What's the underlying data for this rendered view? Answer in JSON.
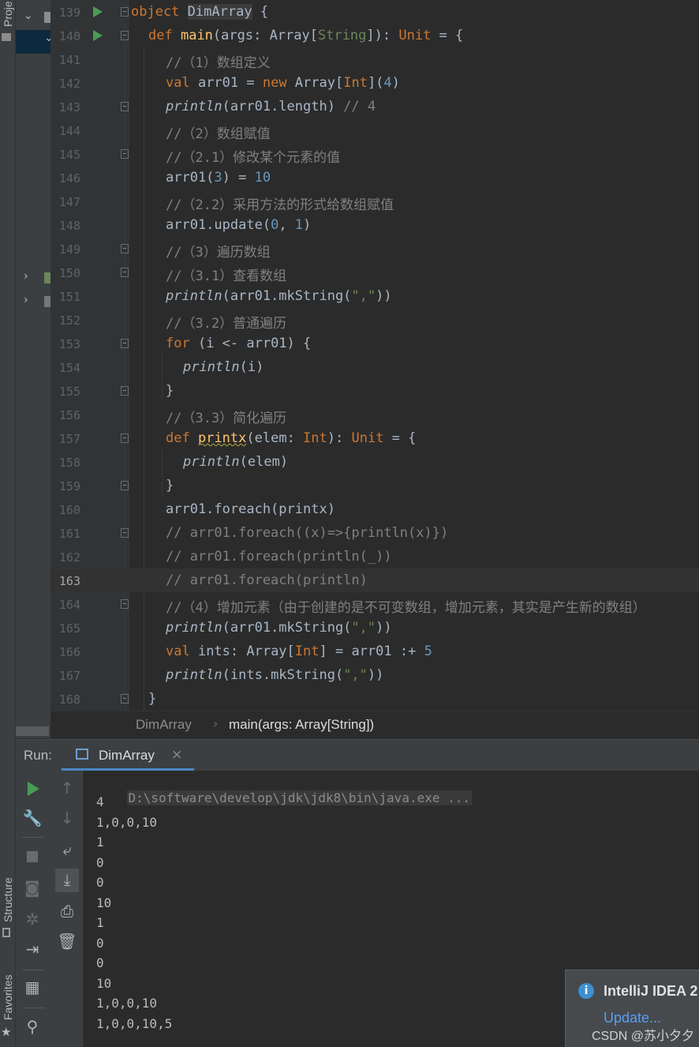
{
  "sidebar": {
    "project_tab": "Proje",
    "structure_tab": "Structure",
    "favorites_tab": "Favorites"
  },
  "editor": {
    "lines": [
      {
        "num": "139",
        "run": true,
        "fold": true
      },
      {
        "num": "140",
        "run": true,
        "fold": true
      },
      {
        "num": "141"
      },
      {
        "num": "142"
      },
      {
        "num": "143",
        "fold": true
      },
      {
        "num": "144"
      },
      {
        "num": "145",
        "fold": true
      },
      {
        "num": "146"
      },
      {
        "num": "147"
      },
      {
        "num": "148"
      },
      {
        "num": "149",
        "fold": true
      },
      {
        "num": "150",
        "fold": true
      },
      {
        "num": "151"
      },
      {
        "num": "152"
      },
      {
        "num": "153",
        "fold": true
      },
      {
        "num": "154"
      },
      {
        "num": "155",
        "fold": true
      },
      {
        "num": "156"
      },
      {
        "num": "157",
        "fold": true
      },
      {
        "num": "158"
      },
      {
        "num": "159",
        "fold": true
      },
      {
        "num": "160"
      },
      {
        "num": "161",
        "fold": true
      },
      {
        "num": "162"
      },
      {
        "num": "163",
        "current": true
      },
      {
        "num": "164",
        "fold": true
      },
      {
        "num": "165"
      },
      {
        "num": "166"
      },
      {
        "num": "167"
      },
      {
        "num": "168",
        "fold": true
      }
    ],
    "code": {
      "l139": {
        "kw": "object",
        "name": "DimArray",
        "rest": " {"
      },
      "l140": {
        "indent": "  ",
        "kw": "def",
        "fn": "main",
        "p1": "(args: Array[",
        "t1": "String",
        "p2": "]): ",
        "t2": "Unit",
        "p3": " = {"
      },
      "l141": "//（1）数组定义",
      "l142": {
        "kw": "val",
        "a": " arr01 = ",
        "kw2": "new",
        "b": " Array[",
        "t": "Int",
        "c": "](",
        "n": "4",
        "d": ")"
      },
      "l143": {
        "it": "println",
        "a": "(arr01.length) ",
        "cmt": "// 4"
      },
      "l144": "//（2）数组赋值",
      "l145": "//（2.1）修改某个元素的值",
      "l146": {
        "a": "arr01(",
        "n1": "3",
        "b": ") = ",
        "n2": "10"
      },
      "l147": "//（2.2）采用方法的形式给数组赋值",
      "l148": {
        "a": "arr01.update(",
        "n1": "0",
        "b": ", ",
        "n2": "1",
        "c": ")"
      },
      "l149": "//（3）遍历数组",
      "l150": "//（3.1）查看数组",
      "l151": {
        "it": "println",
        "a": "(arr01.mkString(",
        "s": "\",\"",
        "b": "))"
      },
      "l152": "//（3.2）普通遍历",
      "l153": {
        "kw": "for",
        "a": " (i <- arr01) {"
      },
      "l154": {
        "it": "println",
        "a": "(i)"
      },
      "l155": "}",
      "l156": "//（3.3）简化遍历",
      "l157": {
        "kw": "def",
        "fn": "printx",
        "a": "(elem: ",
        "t": "Int",
        "b": "): ",
        "t2": "Unit",
        "c": " = {"
      },
      "l158": {
        "it": "println",
        "a": "(elem)"
      },
      "l159": "}",
      "l160": "arr01.foreach(printx)",
      "l161": "// arr01.foreach((x)=>{println(x)})",
      "l162": "// arr01.foreach(println(_))",
      "l163": "// arr01.foreach(println)",
      "l164": "//（4）增加元素（由于创建的是不可变数组，增加元素，其实是产生新的数组）",
      "l165": {
        "it": "println",
        "a": "(arr01.mkString(",
        "s": "\",\"",
        "b": "))"
      },
      "l166": {
        "kw": "val",
        "a": " ints: Array[",
        "t": "Int",
        "b": "] = arr01 :+ ",
        "n": "5"
      },
      "l167": {
        "it": "println",
        "a": "(ints.mkString(",
        "s": "\",\"",
        "b": "))"
      },
      "l168": "}"
    }
  },
  "breadcrumb": {
    "items": [
      "DimArray",
      "main(args: Array[String])"
    ]
  },
  "run": {
    "title": "Run:",
    "tab_label": "DimArray",
    "tab_close": "×",
    "command": "D:\\software\\develop\\jdk\\jdk8\\bin\\java.exe ...",
    "output": [
      "4",
      "1,0,0,10",
      "1",
      "0",
      "0",
      "10",
      "1",
      "0",
      "0",
      "10",
      "1,0,0,10",
      "1,0,0,10,5"
    ]
  },
  "notification": {
    "title": "IntelliJ IDEA 2",
    "link": "Update..."
  },
  "watermark": "CSDN @苏小夕夕",
  "colors": {
    "keyword": "#cc7832",
    "function": "#ffc66d",
    "number": "#6897bb",
    "string": "#6a8759",
    "comment": "#808080",
    "run_icon": "#499c54",
    "link": "#589df6"
  }
}
